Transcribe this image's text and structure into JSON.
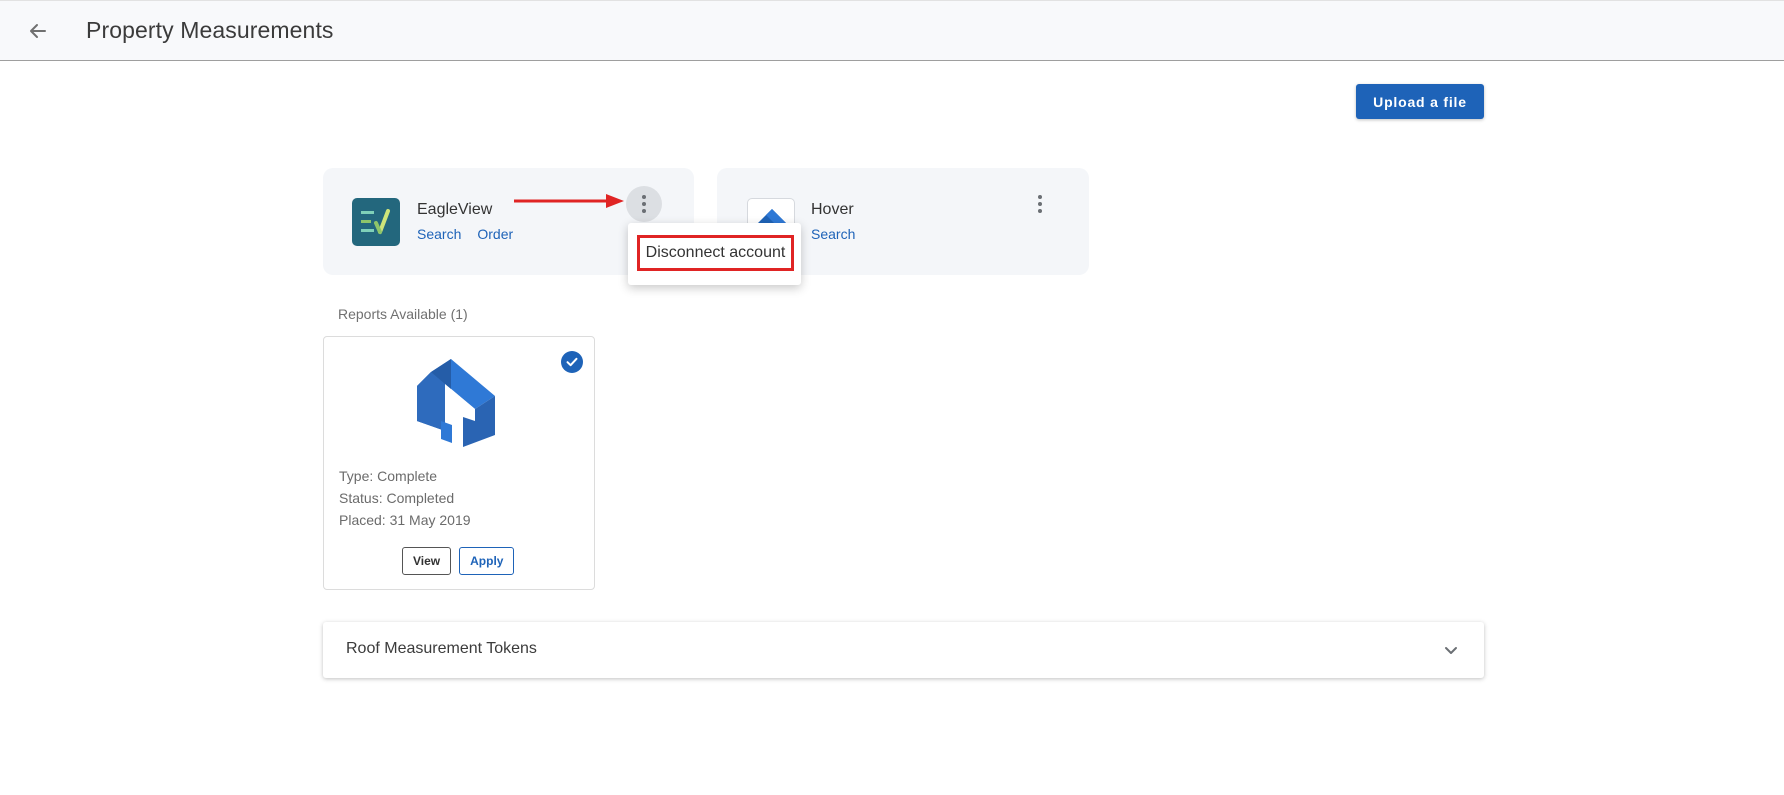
{
  "header": {
    "title": "Property Measurements"
  },
  "toolbar": {
    "upload_label": "Upload a file"
  },
  "providers": [
    {
      "name": "EagleView",
      "links": [
        "Search",
        "Order"
      ],
      "logo": "eagleview-logo"
    },
    {
      "name": "Hover",
      "links": [
        "Search"
      ],
      "logo": "hover-logo"
    }
  ],
  "menu": {
    "items": [
      "Disconnect account"
    ]
  },
  "reports": {
    "title": "Reports Available (1)",
    "items": [
      {
        "type": "Type: Complete",
        "status": "Status: Completed",
        "placed": "Placed: 31 May 2019",
        "view_label": "View",
        "apply_label": "Apply",
        "selected": true
      }
    ]
  },
  "tokens": {
    "label": "Roof Measurement Tokens"
  },
  "colors": {
    "primary": "#1e63b8",
    "highlight": "#e02424",
    "card_bg": "#f4f6f9"
  },
  "icons": [
    "arrow-left-icon",
    "more-vert-icon",
    "check-circle-icon",
    "house-icon",
    "chevron-down-icon"
  ]
}
